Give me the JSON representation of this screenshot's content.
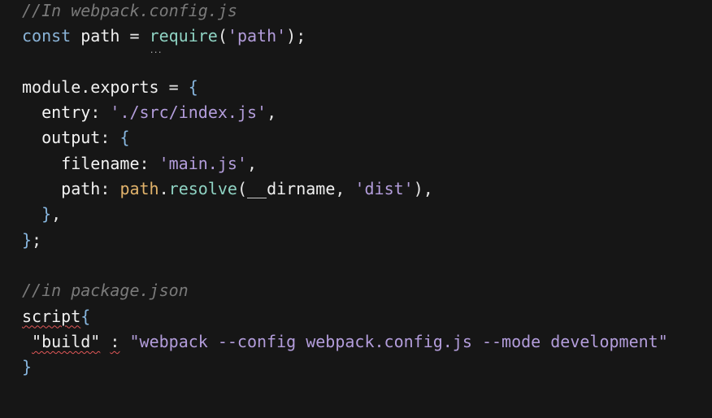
{
  "editor": {
    "lines": [
      {
        "comment": "//In webpack.config.js"
      },
      {
        "kw": "const",
        "name": " path",
        "eq": " = ",
        "fn": "require",
        "open": "(",
        "str": "'path'",
        "close": ");"
      },
      {},
      {
        "name": "module.exports",
        "eq": " = ",
        "brace": "{"
      },
      {
        "indent": "  ",
        "prop": "entry",
        "colon": ": ",
        "str": "'./src/index.js'",
        "comma": ","
      },
      {
        "indent": "  ",
        "prop": "output",
        "colon": ": ",
        "brace": "{"
      },
      {
        "indent": "    ",
        "prop": "filename",
        "colon": ": ",
        "str": "'main.js'",
        "comma": ","
      },
      {
        "indent": "    ",
        "prop": "path",
        "colon": ": ",
        "obj": "path",
        "dot": ".",
        "method": "resolve",
        "open": "(",
        "arg": "__dirname",
        "sep": ", ",
        "str": "'dist'",
        "close": "),",
        "comma": ""
      },
      {
        "indent": "  ",
        "brace": "}",
        "comma": ","
      },
      {
        "brace": "}",
        "comma": ";"
      },
      {},
      {
        "comment": "//in package.json"
      },
      {
        "name": "script",
        "brace": "{"
      },
      {
        "indent": " ",
        "str1": "\"build\"",
        "sep": " ",
        "colon": ":",
        "sep2": " ",
        "str2": "\"webpack --config webpack.config.js --mode development\""
      },
      {
        "brace": "}"
      }
    ]
  }
}
